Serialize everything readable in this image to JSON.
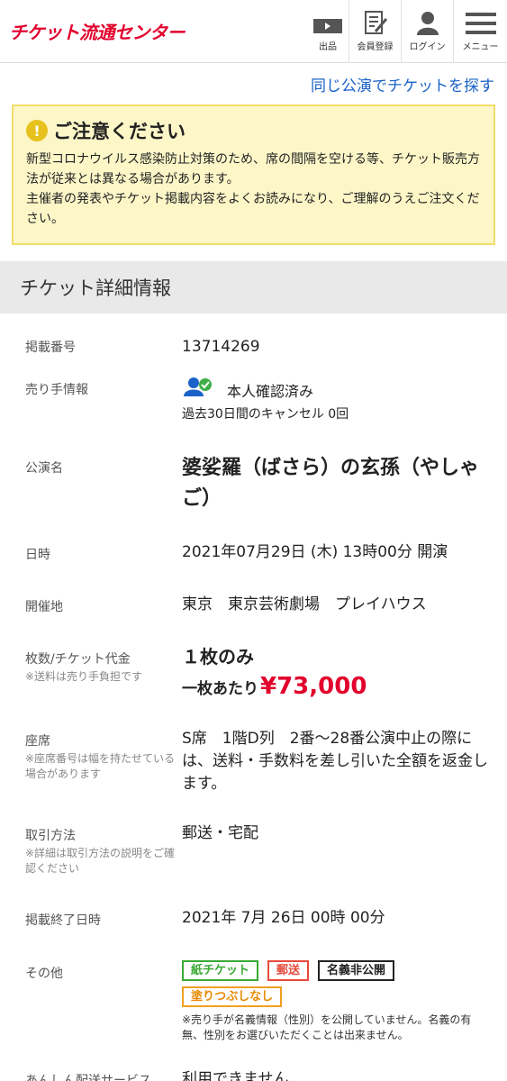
{
  "header": {
    "logo": "チケット流通センター",
    "nav": [
      {
        "label": "出品",
        "icon": "ticket-icon"
      },
      {
        "label": "会員登録",
        "icon": "register-icon"
      },
      {
        "label": "ログイン",
        "icon": "user-icon"
      },
      {
        "label": "メニュー",
        "icon": "menu-icon"
      }
    ]
  },
  "search_link": "同じ公演でチケットを探す",
  "notice": {
    "title": "ご注意ください",
    "line1": "新型コロナウイルス感染防止対策のため、席の間隔を空ける等、チケット販売方法が従来とは異なる場合があります。",
    "line2": "主催者の発表やチケット掲載内容をよくお読みになり、ご理解のうえご注文ください。"
  },
  "section_title": "チケット詳細情報",
  "details": {
    "id": {
      "label": "掲載番号",
      "value": "13714269"
    },
    "seller": {
      "label": "売り手情報",
      "status": "本人確認済み",
      "cancel": "過去30日間のキャンセル 0回"
    },
    "title": {
      "label": "公演名",
      "value": "婆娑羅（ばさら）の玄孫（やしゃご）"
    },
    "date": {
      "label": "日時",
      "value": "2021年07月29日 (木) 13時00分 開演"
    },
    "venue": {
      "label": "開催地",
      "value": "東京　東京芸術劇場　プレイハウス"
    },
    "qty": {
      "label": "枚数/チケット代金",
      "note": "※送料は売り手負担です",
      "value": "１枚のみ",
      "price_per": "一枚あたり",
      "price": "¥73,000"
    },
    "seat": {
      "label": "座席",
      "note": "※座席番号は幅を持たせている場合があります",
      "value": "S席　1階D列　2番〜28番公演中止の際には、送料・手数料を差し引いた全額を返金します。"
    },
    "method": {
      "label": "取引方法",
      "note": "※詳細は取引方法の説明をご確認ください",
      "value": "郵送・宅配"
    },
    "end": {
      "label": "掲載終了日時",
      "value": "2021年 7月 26日 00時 00分"
    },
    "other": {
      "label": "その他",
      "badges": [
        "紙チケット",
        "郵送",
        "名義非公開",
        "塗りつぶしなし"
      ],
      "note": "※売り手が名義情報（性別）を公開していません。名義の有無、性別をお選びいただくことは出来ません。"
    },
    "anshin": {
      "label": "あんしん配送サービス",
      "value": "利用できません"
    }
  },
  "colors": {
    "brand": "#e2002c",
    "link": "#1a62c8",
    "notice_bg": "#fdf7c8"
  }
}
